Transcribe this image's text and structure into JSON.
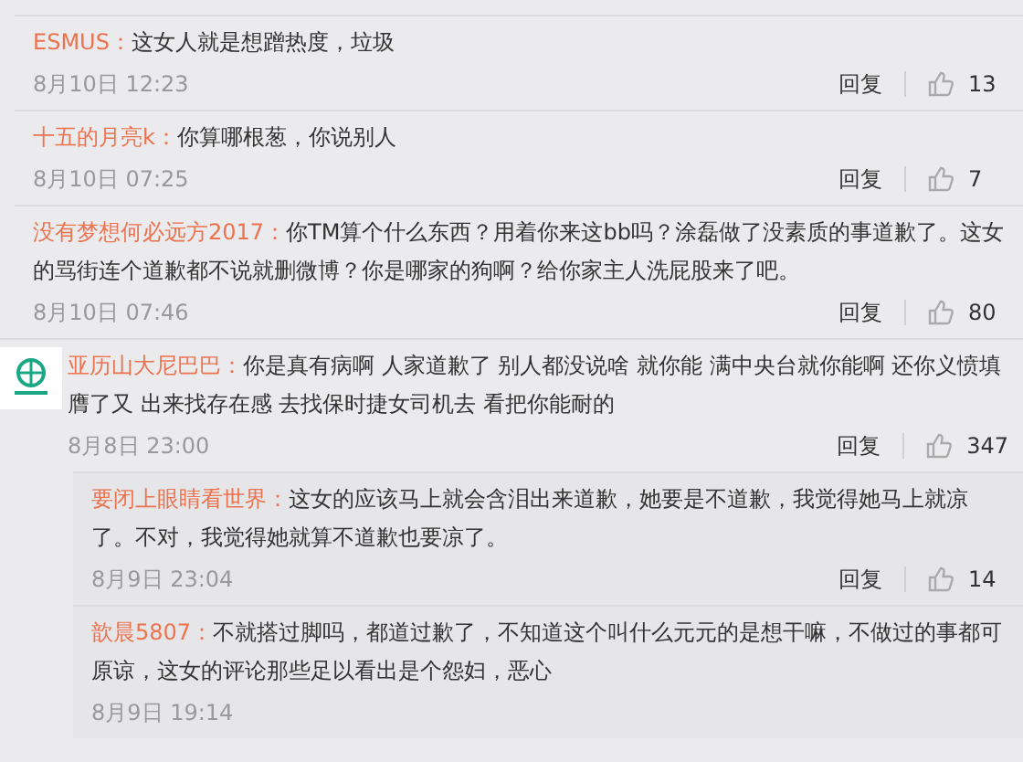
{
  "comments": [
    {
      "user": "ESMUS：",
      "text": "这女人就是想蹭热度，垃圾",
      "time": "8月10日 12:23",
      "reply": "回复",
      "likes": "13"
    },
    {
      "user": "十五的月亮k：",
      "text": "你算哪根葱，你说别人",
      "time": "8月10日 07:25",
      "reply": "回复",
      "likes": "7"
    },
    {
      "user": "没有梦想何必远方2017：",
      "text": "你TM算个什么东西？用着你来这bb吗？涂磊做了没素质的事道歉了。这女的骂街连个道歉都不说就删微博？你是哪家的狗啊？给你家主人洗屁股来了吧。",
      "time": "8月10日 07:46",
      "reply": "回复",
      "likes": "80"
    },
    {
      "user": "亚历山大尼巴巴：",
      "text": "你是真有病啊  人家道歉了 别人都没说啥 就你能  满中央台就你能啊 还你义愤填膺了又  出来找存在感 去找保时捷女司机去  看把你能耐的",
      "time": "8月8日 23:00",
      "reply": "回复",
      "likes": "347",
      "avatar": true,
      "children": [
        {
          "user": "要闭上眼睛看世界：",
          "text": "这女的应该马上就会含泪出来道歉，她要是不道歉，我觉得她马上就凉了。不对，我觉得她就算不道歉也要凉了。",
          "time": "8月9日 23:04",
          "reply": "回复",
          "likes": "14"
        },
        {
          "user": "歆晨5807：",
          "text": "不就搭过脚吗，都道过歉了，不知道这个叫什么元元的是想干嘛，不做过的事都可原谅，这女的评论那些足以看出是个怨妇，恶心",
          "time": "8月9日 19:14"
        }
      ]
    }
  ]
}
